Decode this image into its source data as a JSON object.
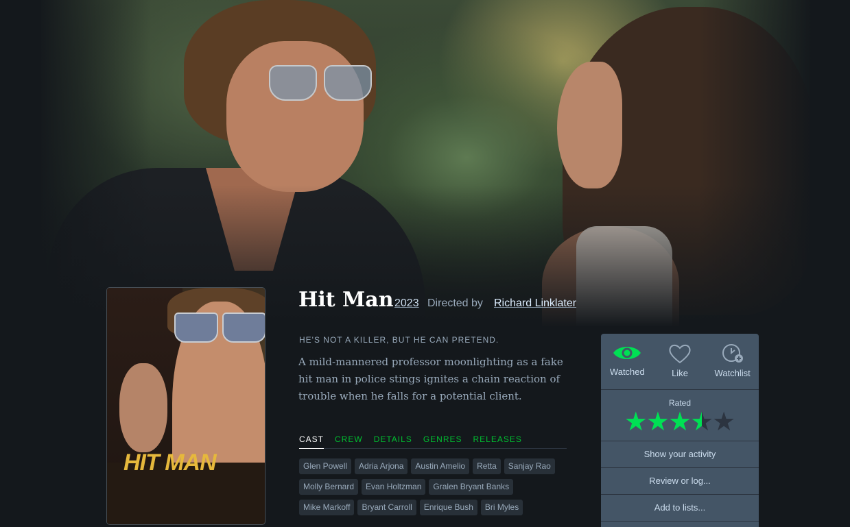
{
  "film": {
    "title": "Hit Man",
    "year": "2023",
    "directed_by_label": "Directed by",
    "director": "Richard Linklater",
    "tagline": "HE'S NOT A KILLER, BUT HE CAN PRETEND.",
    "synopsis": "A mild-mannered professor moonlighting as a fake hit man in police stings ignites a chain reaction of trouble when he falls for a potential client.",
    "poster_title": "HIT MAN"
  },
  "tabs": [
    "CAST",
    "CREW",
    "DETAILS",
    "GENRES",
    "RELEASES"
  ],
  "active_tab": "CAST",
  "cast": [
    [
      "Glen Powell",
      "Adria Arjona",
      "Austin Amelio",
      "Retta",
      "Sanjay Rao"
    ],
    [
      "Molly Bernard",
      "Evan Holtzman",
      "Gralen Bryant Banks"
    ],
    [
      "Mike Markoff",
      "Bryant Carroll",
      "Enrique Bush",
      "Bri Myles"
    ]
  ],
  "panel": {
    "watched_label": "Watched",
    "like_label": "Like",
    "watchlist_label": "Watchlist",
    "rated_label": "Rated",
    "rating_stars": 3.5,
    "rating_max": 5,
    "show_activity": "Show your activity",
    "review_log": "Review or log...",
    "add_lists": "Add to lists..."
  },
  "colors": {
    "accent_green": "#00e054",
    "tab_green": "#00c030",
    "panel_bg": "#445566",
    "page_bg": "#14181c"
  }
}
